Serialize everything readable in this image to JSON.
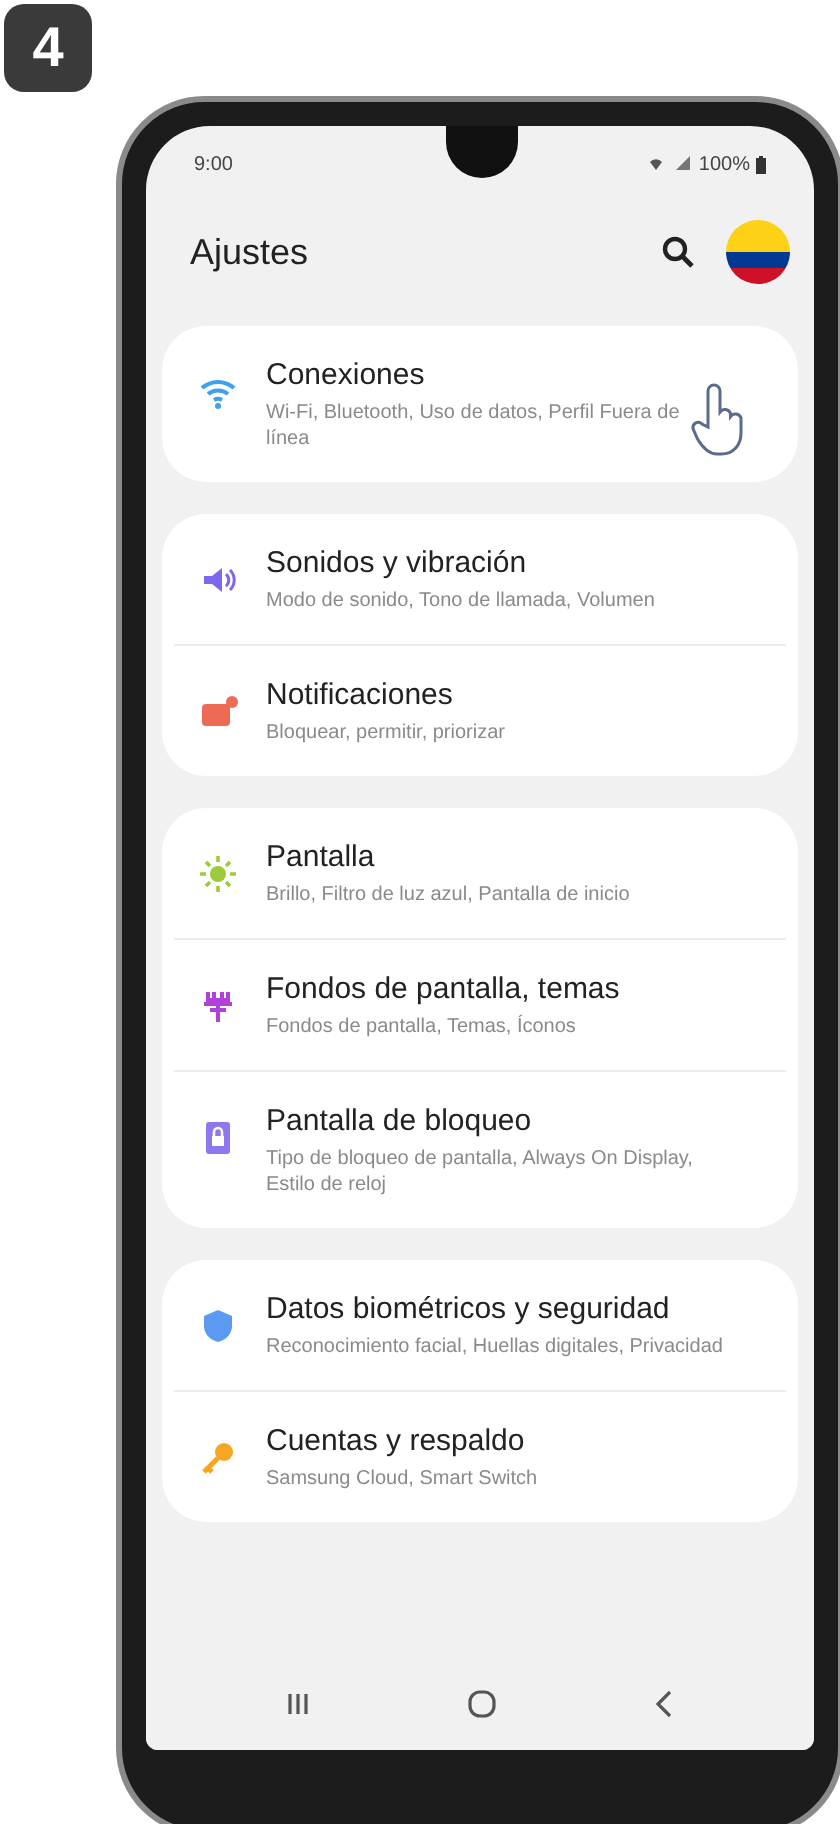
{
  "step_badge": "4",
  "status_bar": {
    "time": "9:00",
    "battery": "100%"
  },
  "header": {
    "title": "Ajustes"
  },
  "groups": [
    {
      "items": [
        {
          "kind": "wifi",
          "title": "Conexiones",
          "subtitle": "Wi-Fi, Bluetooth, Uso de datos, Perfil Fuera de línea"
        }
      ]
    },
    {
      "items": [
        {
          "kind": "sound",
          "title": "Sonidos y vibración",
          "subtitle": "Modo de sonido, Tono de llamada, Volumen"
        },
        {
          "kind": "notification",
          "title": "Notificaciones",
          "subtitle": "Bloquear, permitir, priorizar"
        }
      ]
    },
    {
      "items": [
        {
          "kind": "display",
          "title": "Pantalla",
          "subtitle": "Brillo, Filtro de luz azul, Pantalla de inicio"
        },
        {
          "kind": "theme",
          "title": "Fondos de pantalla, temas",
          "subtitle": "Fondos de pantalla, Temas, Íconos"
        },
        {
          "kind": "lock",
          "title": "Pantalla de bloqueo",
          "subtitle": "Tipo de bloqueo de pantalla, Always On Display, Estilo de reloj"
        }
      ]
    },
    {
      "items": [
        {
          "kind": "security",
          "title": "Datos biométricos y seguridad",
          "subtitle": "Reconocimiento facial, Huellas digitales, Privacidad"
        },
        {
          "kind": "account",
          "title": "Cuentas y respaldo",
          "subtitle": "Samsung Cloud, Smart Switch"
        }
      ]
    }
  ]
}
